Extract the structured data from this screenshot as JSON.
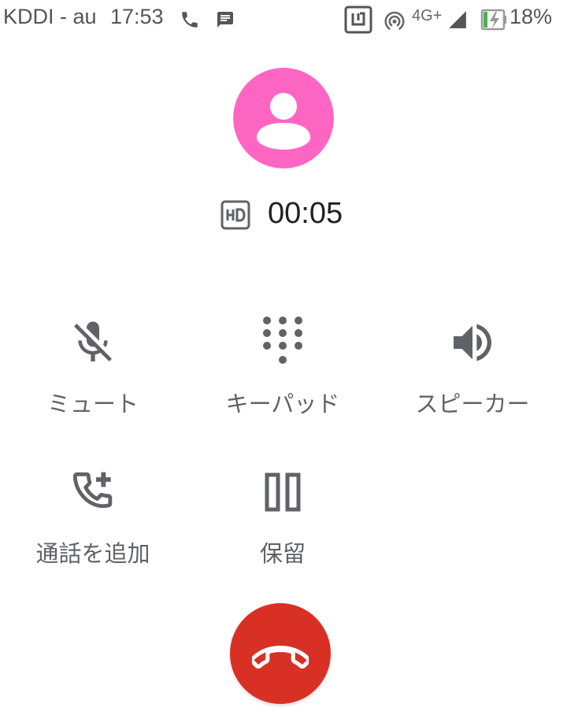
{
  "status_bar": {
    "carrier": "KDDI - au",
    "time": "17:53",
    "network": "4G+",
    "battery": "18%"
  },
  "call": {
    "timer": "00:05"
  },
  "controls": {
    "mute": "ミュート",
    "keypad": "キーパッド",
    "speaker": "スピーカー",
    "add_call": "通話を追加",
    "hold": "保留"
  },
  "colors": {
    "avatar": "#ff66c4",
    "end_call": "#d93025",
    "icon": "#5f6368",
    "battery_accent": "#4caf50"
  },
  "icons": {
    "status_call": "phone-icon",
    "status_message": "message-icon",
    "nfc": "nfc-icon",
    "hotspot": "hotspot-icon",
    "signal": "signal-icon",
    "battery": "battery-charging-icon",
    "hd": "hd-icon",
    "mute": "mic-off-icon",
    "keypad": "dialpad-icon",
    "speaker": "volume-icon",
    "add_call": "add-call-icon",
    "hold": "pause-icon",
    "end_call": "call-end-icon"
  }
}
